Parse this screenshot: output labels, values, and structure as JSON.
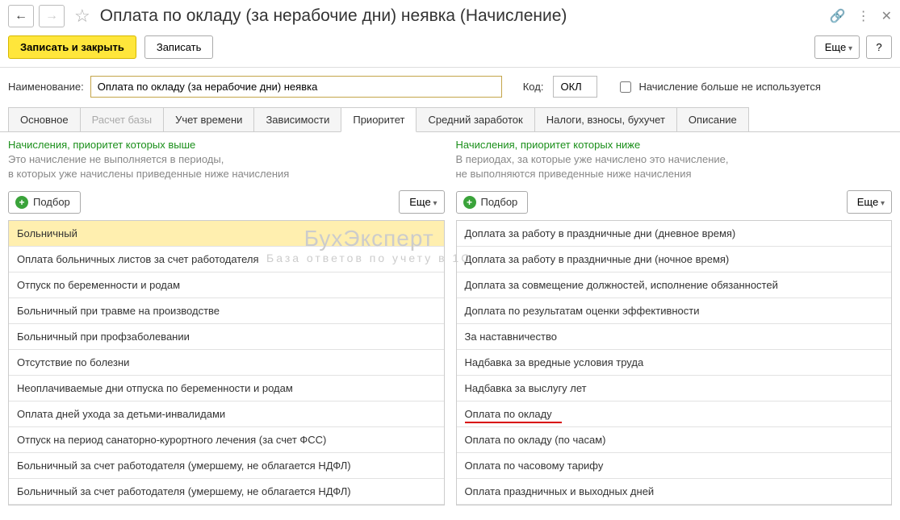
{
  "header": {
    "title": "Оплата по окладу (за нерабочие дни) неявка (Начисление)"
  },
  "toolbar": {
    "save_close": "Записать и закрыть",
    "save": "Записать",
    "more": "Еще",
    "help": "?"
  },
  "form": {
    "name_label": "Наименование:",
    "name_value": "Оплата по окладу (за нерабочие дни) неявка",
    "code_label": "Код:",
    "code_value": "ОКЛ",
    "discontinued_label": "Начисление больше не используется"
  },
  "tabs": {
    "main": "Основное",
    "base": "Расчет базы",
    "time": "Учет времени",
    "deps": "Зависимости",
    "priority": "Приоритет",
    "avg": "Средний заработок",
    "taxes": "Налоги, взносы, бухучет",
    "descr": "Описание"
  },
  "panel_left": {
    "title": "Начисления, приоритет которых выше",
    "hint_l1": "Это начисление не выполняется в периоды,",
    "hint_l2": "в которых уже начислены приведенные ниже начисления",
    "pick": "Подбор",
    "more": "Еще",
    "items": [
      "Больничный",
      "Оплата больничных листов за счет работодателя",
      "Отпуск по беременности и родам",
      "Больничный при травме на производстве",
      "Больничный при профзаболевании",
      "Отсутствие по болезни",
      "Неоплачиваемые дни отпуска по беременности и родам",
      "Оплата дней ухода за детьми-инвалидами",
      "Отпуск на период санаторно-курортного лечения (за счет ФСС)",
      "Больничный за счет работодателя (умершему, не облагается НДФЛ)",
      "Больничный за счет работодателя (умершему, не облагается НДФЛ)"
    ]
  },
  "panel_right": {
    "title": "Начисления, приоритет которых ниже",
    "hint_l1": "В периодах, за которые уже начислено это начисление,",
    "hint_l2": "не выполняются приведенные ниже начисления",
    "pick": "Подбор",
    "more": "Еще",
    "items": [
      "Доплата за работу в праздничные дни (дневное время)",
      "Доплата за работу в праздничные дни (ночное время)",
      "Доплата за совмещение должностей, исполнение обязанностей",
      "Доплата по результатам оценки эффективности",
      "За наставничество",
      "Надбавка за вредные условия труда",
      "Надбавка за выслугу лет",
      "Оплата по окладу",
      "Оплата по окладу (по часам)",
      "Оплата по часовому тарифу",
      "Оплата праздничных и выходных дней"
    ],
    "highlighted_index": 7
  },
  "watermark": {
    "l1": "БухЭксперт",
    "l2": "База ответов по учету в 1С"
  }
}
